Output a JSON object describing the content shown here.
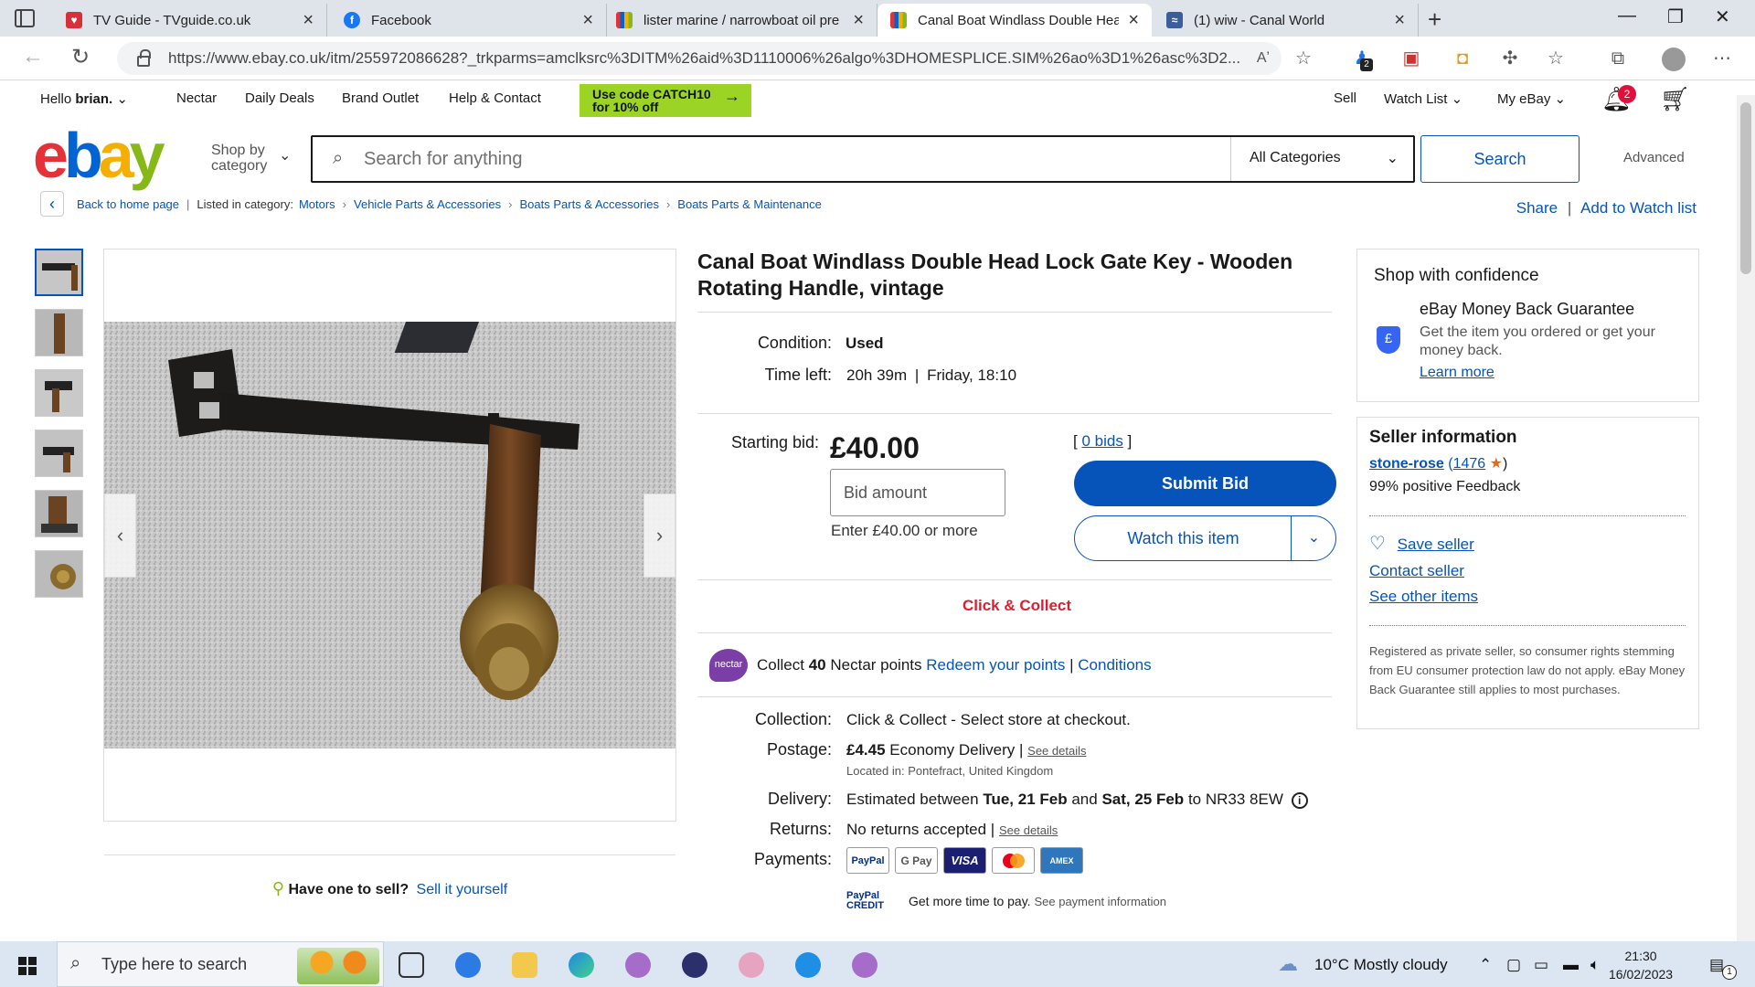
{
  "browser": {
    "tabs": [
      {
        "title": "TV Guide - TVguide.co.uk",
        "fav_color": "#d7303a"
      },
      {
        "title": "Facebook",
        "fav_color": "#1877f2"
      },
      {
        "title": "lister marine / narrowboat oil pre",
        "fav_color": "#e4572e"
      },
      {
        "title": "Canal Boat Windlass Double Hea",
        "fav_color": "#e4572e"
      },
      {
        "title": "(1) wiw - Canal World",
        "fav_color": "#3b5d9c"
      }
    ],
    "url": "https://www.ebay.co.uk/itm/255972086628?_trkparms=amclksrc%3DITM%26aid%3D1110006%26algo%3DHOMESPLICE.SIM%26ao%3D1%26asc%3D2...",
    "ext_badge": "2"
  },
  "topnav": {
    "greeting": "Hello",
    "user": "brian.",
    "links": [
      "Nectar",
      "Daily Deals",
      "Brand Outlet",
      "Help & Contact"
    ],
    "promo_line1": "Use code CATCH10",
    "promo_line2": "for 10% off",
    "sell": "Sell",
    "watch_list": "Watch List",
    "my_ebay": "My eBay",
    "notif_count": "2"
  },
  "search": {
    "shop_by_1": "Shop by",
    "shop_by_2": "category",
    "placeholder": "Search for anything",
    "category": "All Categories",
    "button": "Search",
    "advanced": "Advanced"
  },
  "breadcrumb": {
    "back": "Back to home page",
    "listed": "Listed in category:",
    "items": [
      "Motors",
      "Vehicle Parts & Accessories",
      "Boats Parts & Accessories",
      "Boats Parts & Maintenance"
    ],
    "share": "Share",
    "add_watch": "Add to Watch list"
  },
  "item": {
    "title": "Canal Boat Windlass Double Head Lock Gate Key - Wooden Rotating Handle, vintage",
    "condition_label": "Condition:",
    "condition": "Used",
    "time_label": "Time left:",
    "time_left": "20h 39m",
    "time_end": "Friday, 18:10",
    "bid_label": "Starting bid:",
    "price": "£40.00",
    "bids": "0 bids",
    "bid_placeholder": "Bid amount",
    "bid_hint": "Enter £40.00 or more",
    "submit": "Submit Bid",
    "watch": "Watch this item",
    "click_collect": "Click & Collect",
    "nectar_badge": "nectar",
    "nectar_text": "Collect",
    "nectar_points": "40",
    "nectar_rest": "Nectar points",
    "redeem": "Redeem your points",
    "conditions": "Conditions",
    "collection_label": "Collection:",
    "collection": "Click & Collect - Select store at checkout.",
    "postage_label": "Postage:",
    "postage_price": "£4.45",
    "postage_type": "Economy Delivery |",
    "see_details": "See details",
    "located": "Located in: Pontefract, United Kingdom",
    "delivery_label": "Delivery:",
    "delivery_pre": "Estimated between",
    "delivery_from": "Tue, 21 Feb",
    "delivery_and": "and",
    "delivery_to": "Sat, 25 Feb",
    "delivery_post": "to NR33 8EW",
    "returns_label": "Returns:",
    "returns": "No returns accepted |",
    "payments_label": "Payments:",
    "payment_methods": [
      "PayPal",
      "G Pay",
      "VISA",
      "MC",
      "AMEX"
    ],
    "paypal_credit_1": "PayPal",
    "paypal_credit_2": "CREDIT",
    "credit_text": "Get more time to pay.",
    "credit_link": "See payment information"
  },
  "gallery": {
    "have_one": "Have one to sell?",
    "sell_it": "Sell it yourself"
  },
  "confidence": {
    "title": "Shop with confidence",
    "guarantee_title": "eBay Money Back Guarantee",
    "guarantee_text": "Get the item you ordered or get your money back.",
    "learn_more": "Learn more"
  },
  "seller": {
    "title": "Seller information",
    "name": "stone-rose",
    "rating": "1476",
    "feedback": "99% positive Feedback",
    "save": "Save seller",
    "contact": "Contact seller",
    "other": "See other items",
    "note": "Registered as private seller, so consumer rights stemming from EU consumer protection law do not apply. eBay Money Back Guarantee still applies to most purchases."
  },
  "taskbar": {
    "search_placeholder": "Type here to search",
    "weather": "10°C  Mostly cloudy",
    "time": "21:30",
    "date": "16/02/2023",
    "notif": "1"
  }
}
